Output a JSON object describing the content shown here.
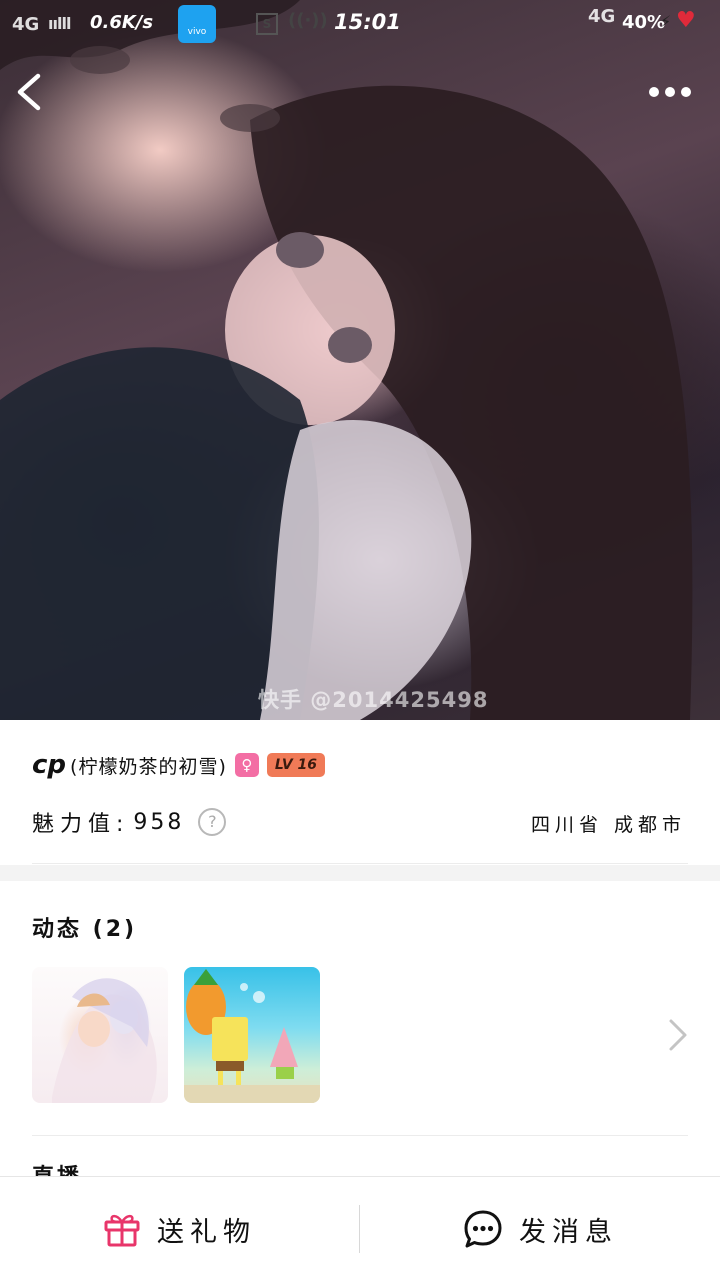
{
  "status_bar": {
    "network": "4G",
    "signal": "ıılll",
    "speed": "0.6K/s",
    "app_icon_label": "vivo",
    "s_icon": "S",
    "time": "15:01",
    "network_right": "4G",
    "battery": "40%"
  },
  "hero": {
    "watermark": "快手 @2014425498"
  },
  "profile": {
    "nickname_main": "cp",
    "nickname_sub": "(柠檬奶茶的初雪)",
    "gender_symbol": "♀",
    "level": "LV 16",
    "charm_label": "魅力值:",
    "charm_value": "958",
    "help_symbol": "?",
    "location": "四川省 成都市"
  },
  "moments": {
    "title": "动态 (2)",
    "next_section_title": "直播"
  },
  "bottom_bar": {
    "gift_label": "送礼物",
    "message_label": "发消息"
  },
  "colors": {
    "gift_icon": "#e8356a",
    "message_icon": "#111111",
    "gender_badge": "#f36ea4",
    "level_badge": "#f07a57",
    "vivo_icon": "#1ea2f0"
  },
  "icons": [
    "back-arrow-icon",
    "more-icon",
    "question-circle-icon",
    "chevron-right-icon",
    "gift-icon",
    "message-bubble-icon"
  ]
}
